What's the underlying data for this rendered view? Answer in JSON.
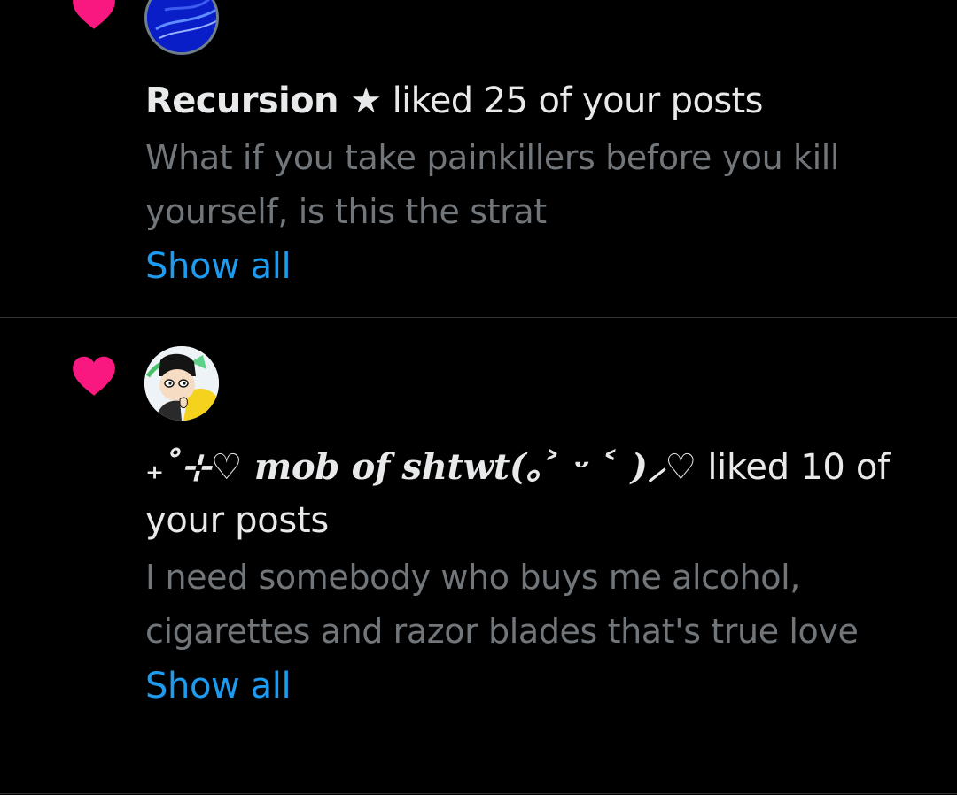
{
  "colors": {
    "background": "#000000",
    "heart": "#f91880",
    "primary_text": "#e7e9ea",
    "secondary_text": "#71767b",
    "link": "#1d9bf0",
    "divider": "#2f3336"
  },
  "notifications": [
    {
      "icon": "heart-icon",
      "username": "Recursion ★",
      "action": " liked 25 of your posts",
      "preview": "What if you take painkillers before you kill yourself, is this the strat",
      "show_all_label": "Show all"
    },
    {
      "icon": "heart-icon",
      "username": "₊˚⊹♡ mob of shtwt(｡˃ ᵕ ˂ )⸝♡",
      "action": " liked 10 of your posts",
      "preview": "I need somebody who buys me alcohol, cigarettes and razor blades that's true love",
      "show_all_label": "Show all"
    }
  ]
}
